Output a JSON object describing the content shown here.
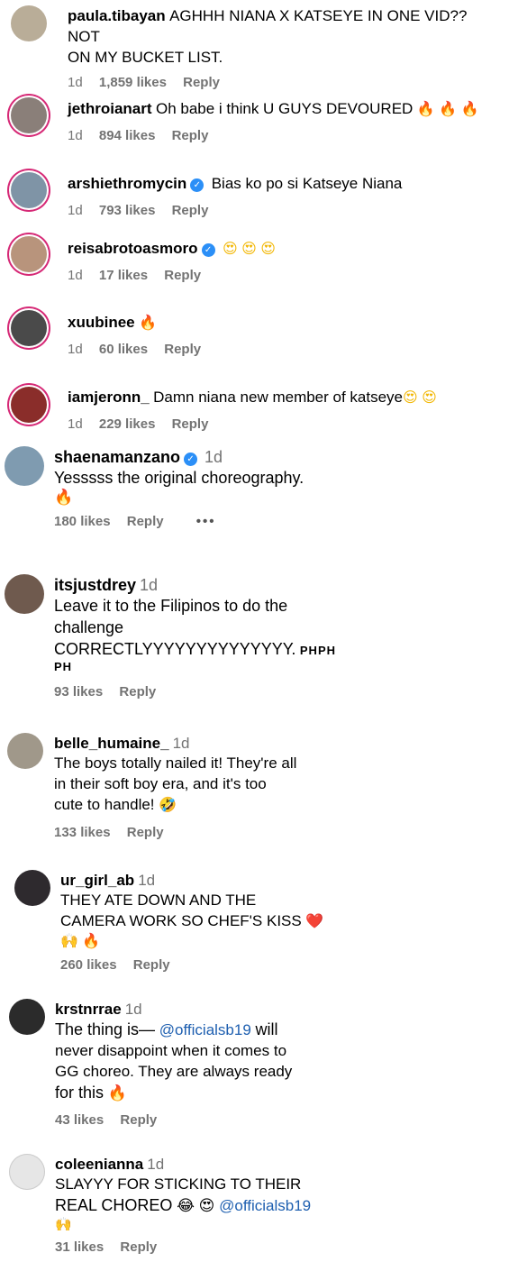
{
  "comments": [
    {
      "user": "paula.tibayan",
      "text": "AGHHH NIANA X KATSEYE IN ONE VID?? NOT",
      "text2": "ON MY BUCKET LIST.",
      "time": "1d",
      "likes": "1,859 likes",
      "reply": "Reply"
    },
    {
      "user": "jethroianart",
      "text": "Oh babe i think U GUYS DEVOURED",
      "emoji": "🔥 🔥 🔥",
      "time": "1d",
      "likes": "894 likes",
      "reply": "Reply"
    },
    {
      "user": "arshiethromycin",
      "text": "Bias ko po si Katseye Niana",
      "time": "1d",
      "likes": "793 likes",
      "reply": "Reply"
    },
    {
      "user": "reisabrotoasmoro",
      "emoji": "😍 😍 😍",
      "time": "1d",
      "likes": "17 likes",
      "reply": "Reply"
    },
    {
      "user": "xuubinee",
      "emoji": "🔥",
      "time": "1d",
      "likes": "60 likes",
      "reply": "Reply"
    },
    {
      "user": "iamjeronn_",
      "text": "Damn niana new member of katseye",
      "emoji": "😍 😍",
      "time": "1d",
      "likes": "229 likes",
      "reply": "Reply"
    },
    {
      "user": "shaenamanzano",
      "time": "1d",
      "text": "Yesssss the original choreography.",
      "emoji": "🔥",
      "likes": "180 likes",
      "reply": "Reply",
      "more": "•••"
    },
    {
      "user": "itsjustdrey",
      "time": "1d",
      "line1": "Leave it to the Filipinos to do the",
      "line2": "challenge",
      "line3": "CORRECTLYYYYYYYYYYYYYY.",
      "flag": "PHPH",
      "line4": "PH",
      "likes": "93 likes",
      "reply": "Reply"
    },
    {
      "user": "belle_humaine_",
      "time": "1d",
      "line1": "The boys totally nailed it! They're all",
      "line2": "in their soft boy era, and it's too",
      "line3": "cute to handle!",
      "emoji": "🤣",
      "likes": "133 likes",
      "reply": "Reply"
    },
    {
      "user": "ur_girl_ab",
      "time": "1d",
      "line1": "THEY ATE DOWN AND THE",
      "line2": "CAMERA WORK SO CHEF'S KISS",
      "heart": "❤️",
      "emoji": "🙌 🔥",
      "likes": "260 likes",
      "reply": "Reply"
    },
    {
      "user": "krstnrrae",
      "time": "1d",
      "line1a": "The thing is—",
      "mention": "@officialsb19",
      "line1b": "will",
      "line2": "never disappoint when it comes to",
      "line3": "GG choreo. They are always ready",
      "line4": "for this",
      "emoji": "🔥",
      "likes": "43 likes",
      "reply": "Reply"
    },
    {
      "user": "coleenianna",
      "time": "1d",
      "line1": "SLAYYY FOR STICKING TO THEIR",
      "line2": "REAL CHOREO",
      "emoji": "😂 😍",
      "mention": "@officialsb19",
      "emoji2": "🙌",
      "likes": "31 likes",
      "reply": "Reply"
    }
  ],
  "colors": {
    "ring": "#d62976",
    "verified": "#2b8ff7",
    "mention": "#1e5fb0",
    "meta": "#737373"
  }
}
